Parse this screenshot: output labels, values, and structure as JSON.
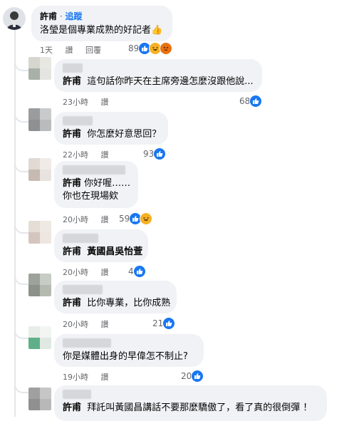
{
  "root": {
    "author": "許甫",
    "follow_sep": " · ",
    "follow_label": "追蹤",
    "text": "洛瑩是個專業成熟的好記者",
    "emoji": "👍",
    "time": "1天",
    "like_label": "讚",
    "reply_label": "回覆",
    "react_count": "89"
  },
  "replies": [
    {
      "mention": "許甫",
      "text": "這句話你昨天在主席旁邊怎麼沒跟他說...",
      "time": "23小時",
      "like_label": "讚",
      "react_count": "68"
    },
    {
      "mention": "許甫",
      "text": "你怎麼好意思回？",
      "time": "22小時",
      "like_label": "讚",
      "react_count": "93"
    },
    {
      "mention": "許甫",
      "text": "你好喔……",
      "text2": "你也在現場欸",
      "time": "20小時",
      "like_label": "讚",
      "react_count": "59"
    },
    {
      "mention": "許甫",
      "text": "黃國昌吳怡萱",
      "time": "20小時",
      "like_label": "讚",
      "react_count": "4"
    },
    {
      "mention": "許甫",
      "text": "比你專業，比你成熟",
      "time": "20小時",
      "like_label": "讚",
      "react_count": "21"
    },
    {
      "mention": "",
      "text": "你是媒體出身的早偉怎不制止?",
      "time": "19小時",
      "like_label": "讚",
      "react_count": "20"
    },
    {
      "mention": "許甫",
      "text": "拜託叫黃國昌講話不要那麼驕傲了，看了真的很倒彈 ！"
    }
  ],
  "colors": {
    "bubble": "#f0f2f5",
    "link": "#1877f2",
    "meta": "#65676b"
  },
  "icons": [
    "like-icon",
    "haha-icon",
    "angry-icon"
  ]
}
